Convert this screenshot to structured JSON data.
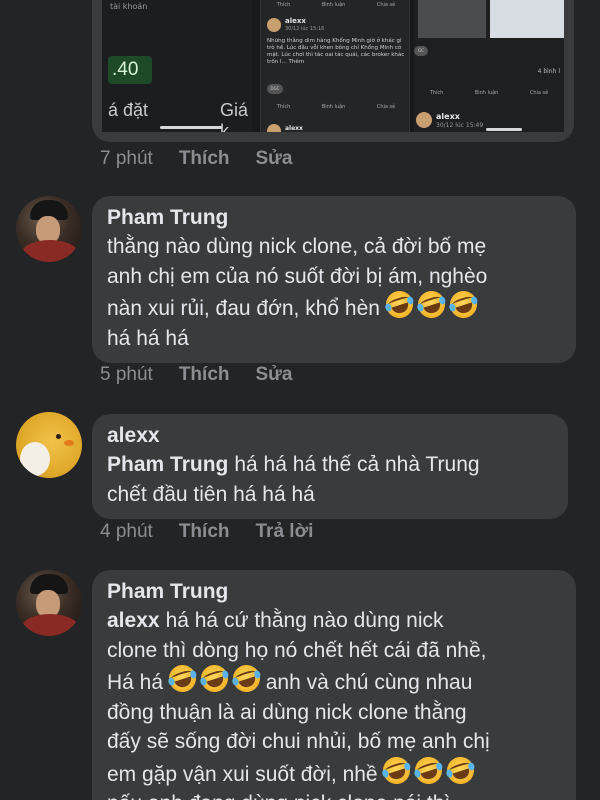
{
  "shared_screenshot": {
    "left_tag": "tài khoản",
    "price": ".40",
    "label_dat": "á đặt",
    "label_gia": "Giá k",
    "post": {
      "top_actions": [
        "Thích",
        "Bình luận",
        "Chia sẻ"
      ],
      "author": "alexx",
      "date": "30/12 lúc 15:16",
      "text": "Những thằng dim hàng Khổng Minh giờ ở khác gì trò hề. Lúc đầu vỗi khen bông chỉ Khổng Minh có mặt. Lúc chơi thì tác oai tác quái, các broker khác trốn l... Thêm",
      "chip": "DGC",
      "actions": [
        "Thích",
        "Bình luận",
        "Chia sẻ"
      ],
      "author2": "alexx"
    },
    "right": {
      "chip": "GC",
      "count": "4 bình l",
      "actions": [
        "Thích",
        "Bình luận",
        "Chia sẻ"
      ],
      "author": "alexx",
      "date": "30/12 lúc 15:49"
    }
  },
  "rows": [
    {
      "time": "7 phút",
      "like": "Thích",
      "action": "Sửa"
    }
  ],
  "comments": [
    {
      "author": "Pham Trung",
      "line1": "thằng nào dùng nick clone, cả đời bố mẹ",
      "line2": "anh chị em của nó suốt đời bị ám, nghèo",
      "line3": "nàn xui rủi, đau đớn, khổ hèn",
      "line4": "há há há",
      "time": "5 phút",
      "like": "Thích",
      "action": "Sửa"
    },
    {
      "author": "alexx",
      "mention": "Pham Trung",
      "line1": "há há há thế cả nhà Trung",
      "line2": "chết đầu tiên há há há",
      "time": "4 phút",
      "like": "Thích",
      "action": "Trả lời"
    },
    {
      "author": "Pham Trung",
      "mention": "alexx",
      "line1": "há há cứ thằng nào dùng nick",
      "line2": "clone thì dòng họ nó chết hết cái đã nhề,",
      "line3a": "Há há",
      "line3b": "anh và chú cùng nhau",
      "line4": "đồng thuận là ai dùng nick clone thằng",
      "line5": "đấy sẽ sống đời chui nhủi, bố mẹ anh chị",
      "line6": "em gặp vận xui suốt đời, nhề",
      "line7": "nếu anh đang dùng nick clone nói thì"
    }
  ],
  "emoji_name": "rolling-on-floor-laughing"
}
